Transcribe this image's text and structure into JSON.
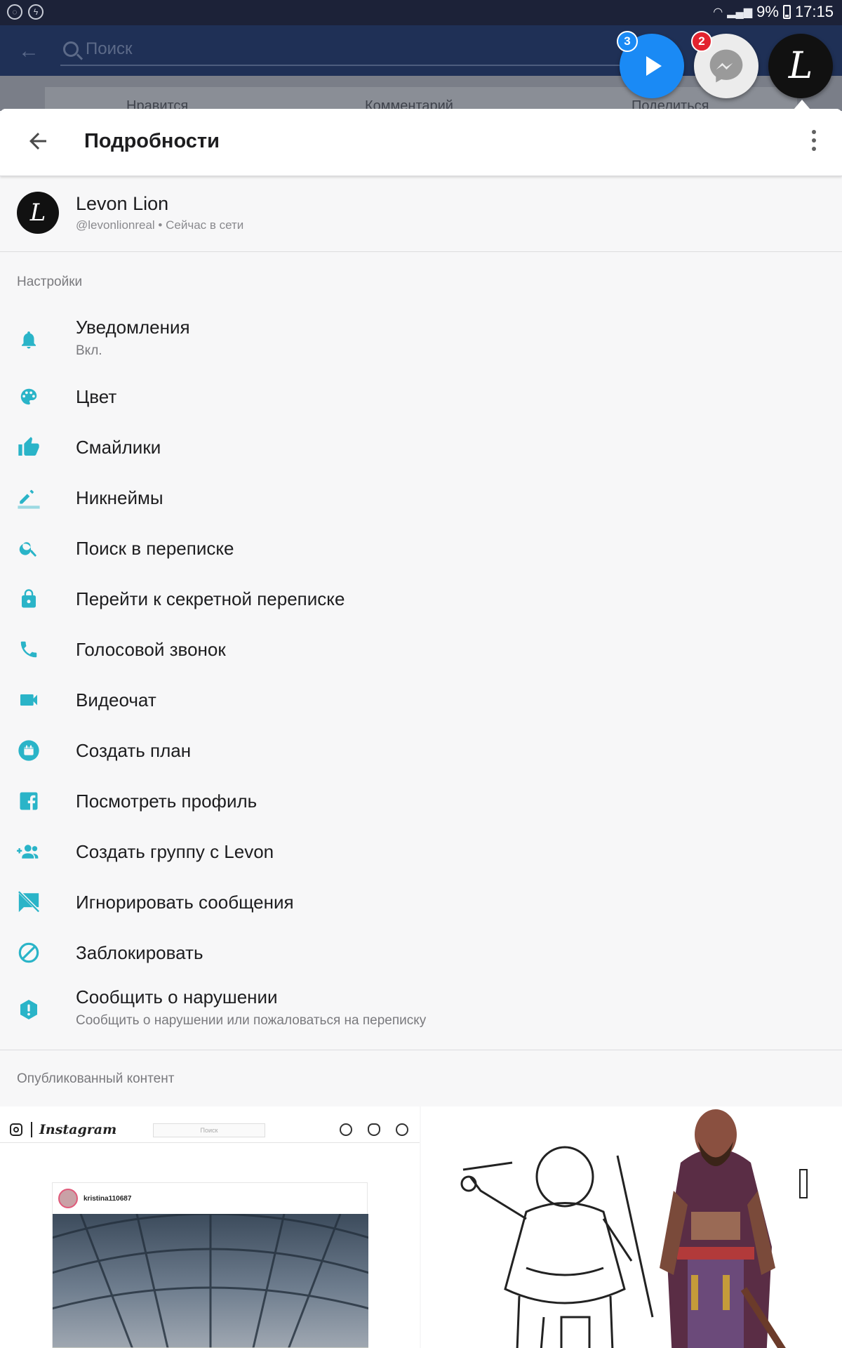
{
  "status_bar": {
    "battery": "9%",
    "time": "17:15"
  },
  "background": {
    "search_placeholder": "Поиск",
    "actions": [
      "Нравится",
      "Комментарий",
      "Поделиться"
    ]
  },
  "chat_heads": [
    {
      "name": "video-chat-head",
      "badge": "3"
    },
    {
      "name": "messenger-chat-head",
      "badge": "2"
    },
    {
      "name": "user-chat-head",
      "initial": "L"
    }
  ],
  "toolbar": {
    "title": "Подробности"
  },
  "profile": {
    "initial": "L",
    "name": "Levon Lion",
    "subtitle": "@levonlionreal • Сейчас в сети"
  },
  "settings": {
    "section_title": "Настройки",
    "items": [
      {
        "icon": "bell-icon",
        "label": "Уведомления",
        "sub": "Вкл."
      },
      {
        "icon": "palette-icon",
        "label": "Цвет"
      },
      {
        "icon": "thumbs-up-icon",
        "label": "Смайлики"
      },
      {
        "icon": "pencil-icon",
        "label": "Никнеймы"
      },
      {
        "icon": "search-icon",
        "label": "Поиск в переписке"
      },
      {
        "icon": "lock-icon",
        "label": "Перейти к секретной переписке"
      },
      {
        "icon": "phone-icon",
        "label": "Голосовой звонок"
      },
      {
        "icon": "video-camera-icon",
        "label": "Видеочат"
      },
      {
        "icon": "calendar-icon",
        "label": "Создать план"
      },
      {
        "icon": "facebook-icon",
        "label": "Посмотреть профиль"
      },
      {
        "icon": "add-group-icon",
        "label": "Создать группу с Levon"
      },
      {
        "icon": "mute-message-icon",
        "label": "Игнорировать сообщения"
      },
      {
        "icon": "block-icon",
        "label": "Заблокировать"
      },
      {
        "icon": "report-icon",
        "label": "Сообщить о нарушении",
        "sub": "Сообщить о нарушении или пожаловаться на переписку"
      }
    ]
  },
  "published": {
    "title": "Опубликованный контент",
    "thumb1": {
      "brand": "Instagram",
      "search": "Поиск",
      "username": "kristina110687"
    }
  },
  "colors": {
    "accent": "#2ab4c8",
    "header": "#1f3056",
    "messenger_blue": "#1a8af5",
    "badge_red": "#e3232f"
  }
}
